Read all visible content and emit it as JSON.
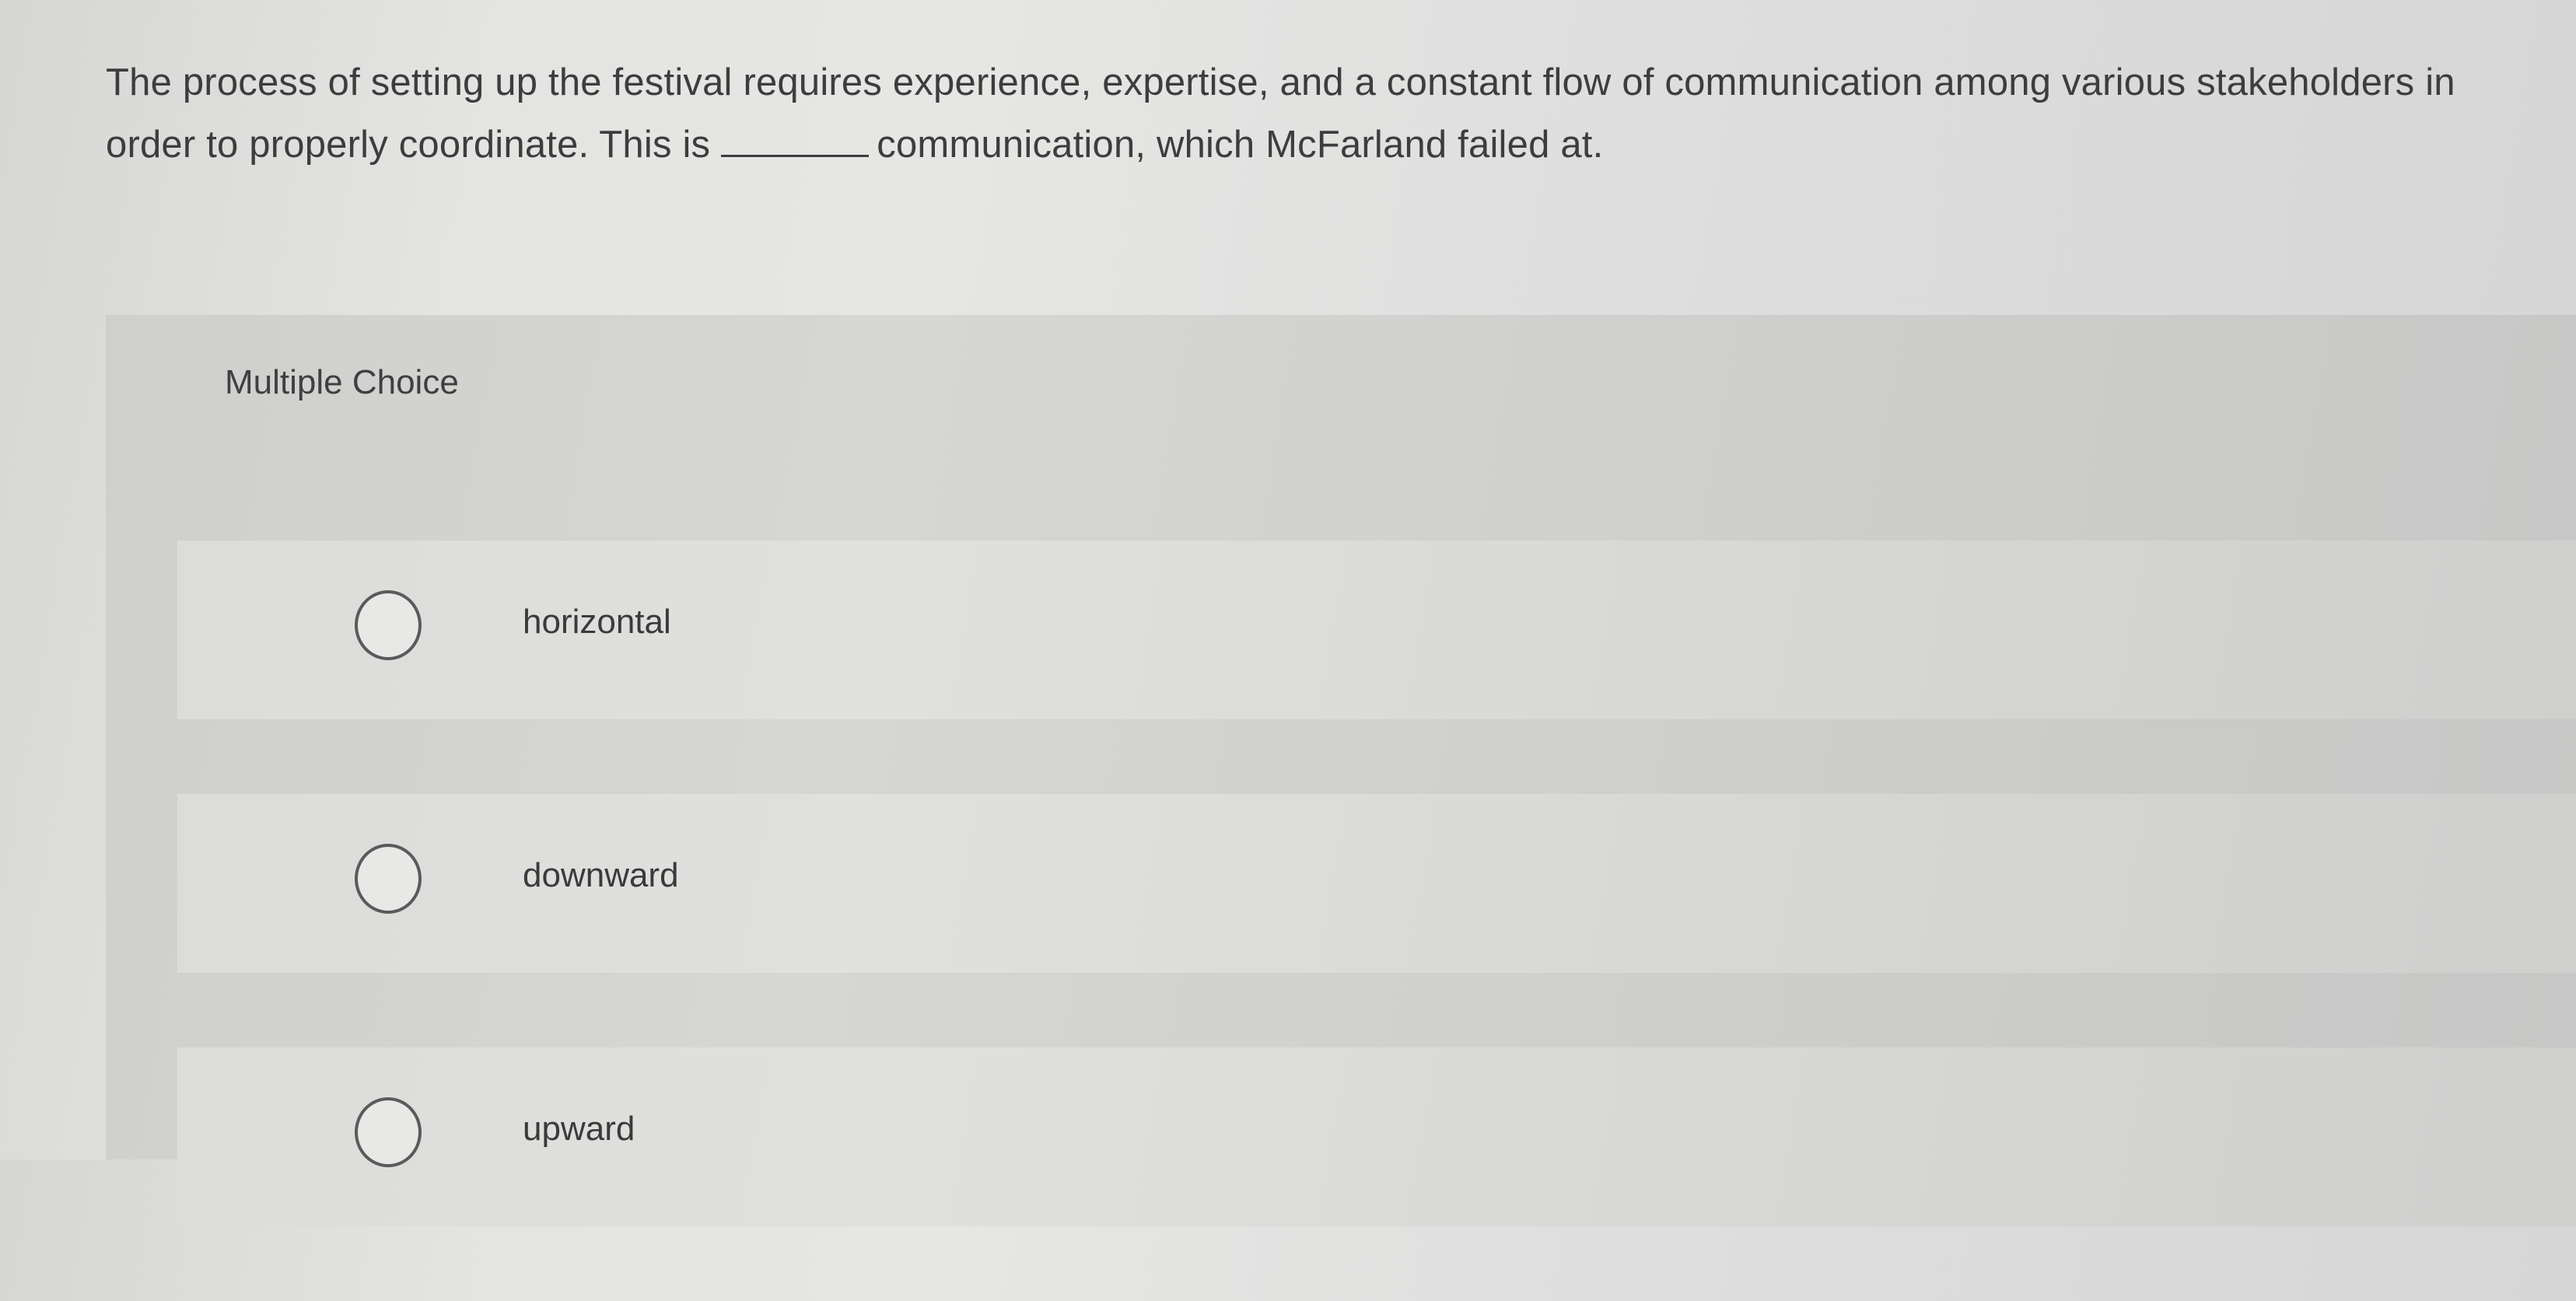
{
  "question": {
    "text_before_blank": "The process of setting up the festival requires experience, expertise, and a constant flow of communication among various stakeholders in order to properly coordinate. This is",
    "text_after_blank": "communication, which McFarland failed at."
  },
  "multiple_choice": {
    "title": "Multiple Choice",
    "options": [
      {
        "label": "horizontal",
        "selected": false
      },
      {
        "label": "downward",
        "selected": false
      },
      {
        "label": "upward",
        "selected": false
      }
    ]
  }
}
